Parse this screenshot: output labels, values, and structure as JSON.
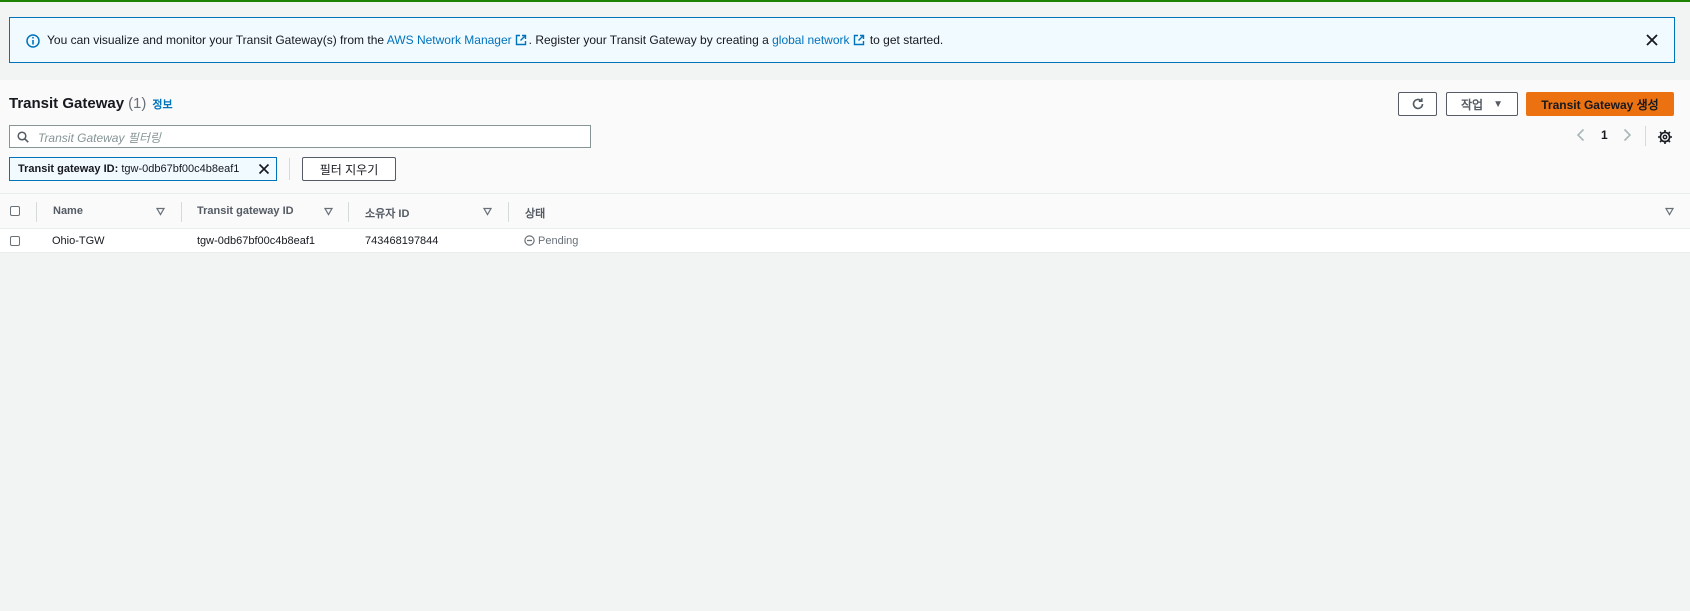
{
  "banner": {
    "text_1": "You can visualize and monitor your Transit Gateway(s) from the ",
    "link_1": "AWS Network Manager",
    "text_2": ". Register your Transit Gateway by creating a ",
    "link_2": "global network",
    "text_3": " to get started."
  },
  "header": {
    "title": "Transit Gateway",
    "count": "(1)",
    "info_link": "정보",
    "actions_label": "작업",
    "create_label": "Transit Gateway 생성"
  },
  "search": {
    "placeholder": "Transit Gateway 필터링"
  },
  "pagination": {
    "current_page": "1"
  },
  "filter_token": {
    "key": "Transit gateway ID:",
    "value": "tgw-0db67bf00c4b8eaf1"
  },
  "clear_filters_label": "필터 지우기",
  "table": {
    "columns": [
      "Name",
      "Transit gateway ID",
      "소유자 ID",
      "상태"
    ],
    "rows": [
      {
        "name": "Ohio-TGW",
        "tgw_id": "tgw-0db67bf00c4b8eaf1",
        "owner_id": "743468197844",
        "state": "Pending"
      }
    ]
  },
  "colors": {
    "accent": "#0073bb",
    "primary_button": "#ec7211",
    "top_border": "#1d8102"
  }
}
